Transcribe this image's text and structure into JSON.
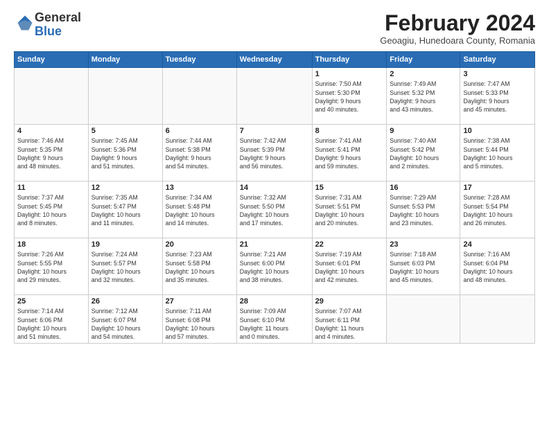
{
  "header": {
    "logo_general": "General",
    "logo_blue": "Blue",
    "month_title": "February 2024",
    "location": "Geoagiu, Hunedoara County, Romania"
  },
  "weekdays": [
    "Sunday",
    "Monday",
    "Tuesday",
    "Wednesday",
    "Thursday",
    "Friday",
    "Saturday"
  ],
  "weeks": [
    [
      {
        "day": "",
        "info": ""
      },
      {
        "day": "",
        "info": ""
      },
      {
        "day": "",
        "info": ""
      },
      {
        "day": "",
        "info": ""
      },
      {
        "day": "1",
        "info": "Sunrise: 7:50 AM\nSunset: 5:30 PM\nDaylight: 9 hours\nand 40 minutes."
      },
      {
        "day": "2",
        "info": "Sunrise: 7:49 AM\nSunset: 5:32 PM\nDaylight: 9 hours\nand 43 minutes."
      },
      {
        "day": "3",
        "info": "Sunrise: 7:47 AM\nSunset: 5:33 PM\nDaylight: 9 hours\nand 45 minutes."
      }
    ],
    [
      {
        "day": "4",
        "info": "Sunrise: 7:46 AM\nSunset: 5:35 PM\nDaylight: 9 hours\nand 48 minutes."
      },
      {
        "day": "5",
        "info": "Sunrise: 7:45 AM\nSunset: 5:36 PM\nDaylight: 9 hours\nand 51 minutes."
      },
      {
        "day": "6",
        "info": "Sunrise: 7:44 AM\nSunset: 5:38 PM\nDaylight: 9 hours\nand 54 minutes."
      },
      {
        "day": "7",
        "info": "Sunrise: 7:42 AM\nSunset: 5:39 PM\nDaylight: 9 hours\nand 56 minutes."
      },
      {
        "day": "8",
        "info": "Sunrise: 7:41 AM\nSunset: 5:41 PM\nDaylight: 9 hours\nand 59 minutes."
      },
      {
        "day": "9",
        "info": "Sunrise: 7:40 AM\nSunset: 5:42 PM\nDaylight: 10 hours\nand 2 minutes."
      },
      {
        "day": "10",
        "info": "Sunrise: 7:38 AM\nSunset: 5:44 PM\nDaylight: 10 hours\nand 5 minutes."
      }
    ],
    [
      {
        "day": "11",
        "info": "Sunrise: 7:37 AM\nSunset: 5:45 PM\nDaylight: 10 hours\nand 8 minutes."
      },
      {
        "day": "12",
        "info": "Sunrise: 7:35 AM\nSunset: 5:47 PM\nDaylight: 10 hours\nand 11 minutes."
      },
      {
        "day": "13",
        "info": "Sunrise: 7:34 AM\nSunset: 5:48 PM\nDaylight: 10 hours\nand 14 minutes."
      },
      {
        "day": "14",
        "info": "Sunrise: 7:32 AM\nSunset: 5:50 PM\nDaylight: 10 hours\nand 17 minutes."
      },
      {
        "day": "15",
        "info": "Sunrise: 7:31 AM\nSunset: 5:51 PM\nDaylight: 10 hours\nand 20 minutes."
      },
      {
        "day": "16",
        "info": "Sunrise: 7:29 AM\nSunset: 5:53 PM\nDaylight: 10 hours\nand 23 minutes."
      },
      {
        "day": "17",
        "info": "Sunrise: 7:28 AM\nSunset: 5:54 PM\nDaylight: 10 hours\nand 26 minutes."
      }
    ],
    [
      {
        "day": "18",
        "info": "Sunrise: 7:26 AM\nSunset: 5:55 PM\nDaylight: 10 hours\nand 29 minutes."
      },
      {
        "day": "19",
        "info": "Sunrise: 7:24 AM\nSunset: 5:57 PM\nDaylight: 10 hours\nand 32 minutes."
      },
      {
        "day": "20",
        "info": "Sunrise: 7:23 AM\nSunset: 5:58 PM\nDaylight: 10 hours\nand 35 minutes."
      },
      {
        "day": "21",
        "info": "Sunrise: 7:21 AM\nSunset: 6:00 PM\nDaylight: 10 hours\nand 38 minutes."
      },
      {
        "day": "22",
        "info": "Sunrise: 7:19 AM\nSunset: 6:01 PM\nDaylight: 10 hours\nand 42 minutes."
      },
      {
        "day": "23",
        "info": "Sunrise: 7:18 AM\nSunset: 6:03 PM\nDaylight: 10 hours\nand 45 minutes."
      },
      {
        "day": "24",
        "info": "Sunrise: 7:16 AM\nSunset: 6:04 PM\nDaylight: 10 hours\nand 48 minutes."
      }
    ],
    [
      {
        "day": "25",
        "info": "Sunrise: 7:14 AM\nSunset: 6:06 PM\nDaylight: 10 hours\nand 51 minutes."
      },
      {
        "day": "26",
        "info": "Sunrise: 7:12 AM\nSunset: 6:07 PM\nDaylight: 10 hours\nand 54 minutes."
      },
      {
        "day": "27",
        "info": "Sunrise: 7:11 AM\nSunset: 6:08 PM\nDaylight: 10 hours\nand 57 minutes."
      },
      {
        "day": "28",
        "info": "Sunrise: 7:09 AM\nSunset: 6:10 PM\nDaylight: 11 hours\nand 0 minutes."
      },
      {
        "day": "29",
        "info": "Sunrise: 7:07 AM\nSunset: 6:11 PM\nDaylight: 11 hours\nand 4 minutes."
      },
      {
        "day": "",
        "info": ""
      },
      {
        "day": "",
        "info": ""
      }
    ]
  ]
}
